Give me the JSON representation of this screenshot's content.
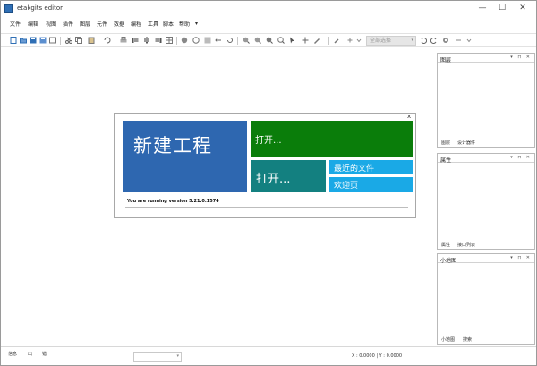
{
  "window": {
    "title": "etakgits editor",
    "minimize": "—",
    "maximize": "☐",
    "close": "✕"
  },
  "menu": [
    "文件",
    "编辑",
    "视图",
    "插件",
    "图层",
    "元件",
    "数据",
    "编程",
    "工具",
    "脚本",
    "帮助"
  ],
  "menu_more": "▾",
  "toolbar": {
    "combo_value": "全部选择",
    "combo_arrow": "▾",
    "accent": "#2f6fb5"
  },
  "start_page": {
    "close": "x",
    "new_project": "新建工程",
    "open_top": "打开...",
    "open_bottom": "打开...",
    "recent_files": "最近的文件",
    "welcome": "欢迎页",
    "version": "You are running version 5.21.0.1574",
    "colors": {
      "new": "#2e67b0",
      "open_top": "#0a7d0a",
      "open_bottom": "#138080",
      "recent": "#1aa9e6"
    }
  },
  "panels": [
    {
      "title": "图层",
      "controls": "▾ ⊓ ✕",
      "tabs": [
        "图层",
        "设计器件"
      ]
    },
    {
      "title": "属性",
      "controls": "▾ ⊓ ✕",
      "tabs": [
        "属性",
        "接口列表"
      ]
    },
    {
      "title": "小地图",
      "controls": "▾ ⊓ ✕",
      "tabs": [
        "小地图",
        "搜索"
      ]
    }
  ],
  "statusbar": {
    "tabs": [
      "信息",
      "出",
      "错"
    ],
    "field_arrow": "▾",
    "coords": "X : 0.0000 | Y : 0.0000"
  }
}
